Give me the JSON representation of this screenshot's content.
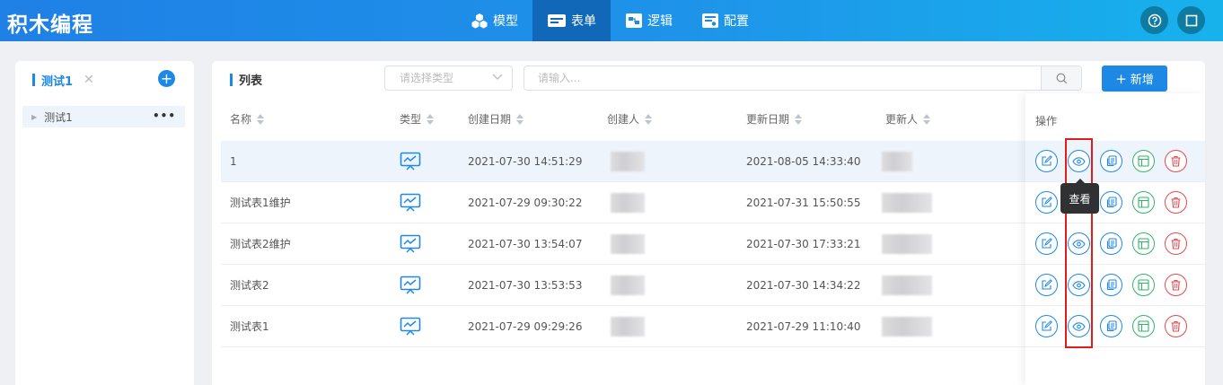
{
  "app": {
    "title": "积木编程"
  },
  "nav": [
    {
      "label": "模型",
      "icon": "cubes-icon",
      "active": false
    },
    {
      "label": "表单",
      "icon": "form-icon",
      "active": true
    },
    {
      "label": "逻辑",
      "icon": "logic-icon",
      "active": false
    },
    {
      "label": "配置",
      "icon": "config-icon",
      "active": false
    }
  ],
  "topbar_buttons": [
    "help-icon",
    "fullscreen-icon"
  ],
  "left_panel": {
    "tab_label": "测试1",
    "close_symbol": "✕",
    "add_symbol": "+",
    "tree_item": {
      "label": "测试1",
      "more": "•••"
    }
  },
  "main": {
    "title": "列表",
    "type_select_placeholder": "请选择类型",
    "search_placeholder": "请输入...",
    "add_button": "新增",
    "add_button_symbol": "+",
    "columns": [
      "名称",
      "类型",
      "创建日期",
      "创建人",
      "更新日期",
      "更新人"
    ],
    "ops_header": "操作",
    "rows": [
      {
        "name": "1",
        "created": "2021-07-30 14:51:29",
        "updated": "2021-08-05 14:33:40",
        "highlighted": true
      },
      {
        "name": "测试表1维护",
        "created": "2021-07-29 09:30:22",
        "updated": "2021-07-31 15:50:55",
        "highlighted": false
      },
      {
        "name": "测试表2维护",
        "created": "2021-07-30 13:54:07",
        "updated": "2021-07-30 17:33:21",
        "highlighted": false
      },
      {
        "name": "测试表2",
        "created": "2021-07-30 13:53:53",
        "updated": "2021-07-30 14:34:22",
        "highlighted": false
      },
      {
        "name": "测试表1",
        "created": "2021-07-29 09:29:26",
        "updated": "2021-07-29 11:10:40",
        "highlighted": false
      }
    ],
    "row_actions": [
      "edit-icon",
      "view-icon",
      "copy-icon",
      "layout-icon",
      "delete-icon"
    ],
    "tooltip": "查看"
  },
  "colors": {
    "primary": "#1e88e5",
    "green": "#32b36b",
    "red": "#e5484d",
    "highlight_frame": "#e31b1b"
  }
}
